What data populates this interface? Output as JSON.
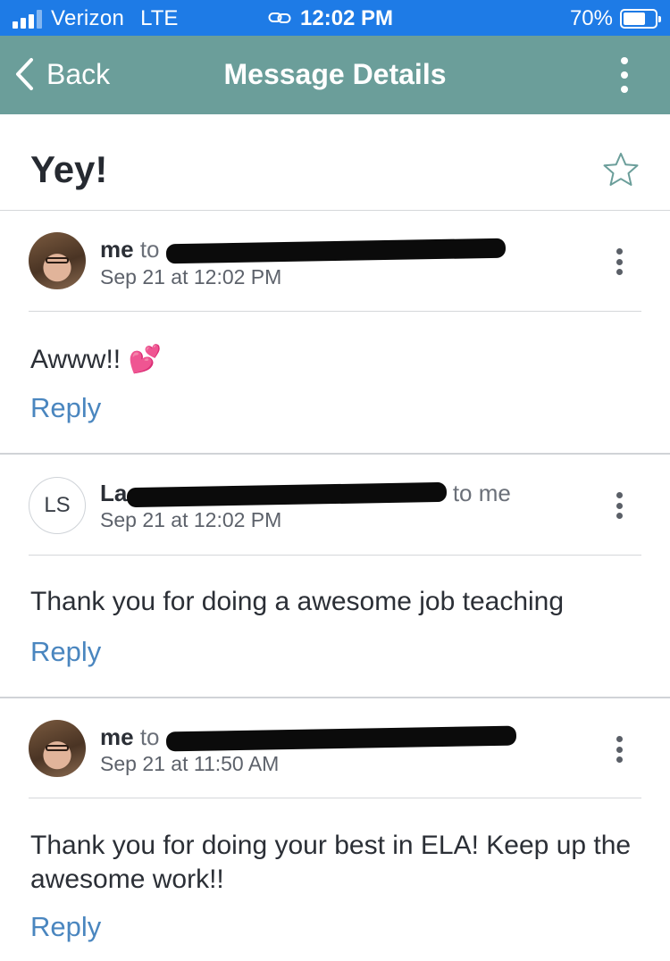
{
  "status_bar": {
    "carrier": "Verizon",
    "network": "LTE",
    "time": "12:02 PM",
    "battery": "70%",
    "battery_level": 0.7
  },
  "nav": {
    "back_label": "Back",
    "title": "Message Details"
  },
  "subject": "Yey!",
  "messages": [
    {
      "sender": "me",
      "to_label": "to",
      "avatar_initials": "",
      "date": "Sep 21 at 12:02 PM",
      "body": "Awww!! 💕",
      "reply_label": "Reply"
    },
    {
      "sender": "La",
      "to_label": "to me",
      "avatar_initials": "LS",
      "date": "Sep 21 at 12:02 PM",
      "body": "Thank you for doing a awesome job teaching",
      "reply_label": "Reply"
    },
    {
      "sender": "me",
      "to_label": "to",
      "avatar_initials": "",
      "date": "Sep 21 at 11:50 AM",
      "body": "Thank you for doing your best in ELA! Keep up the awesome work!!",
      "reply_label": "Reply"
    }
  ],
  "colors": {
    "status_bar": "#1e7be6",
    "nav_bar": "#6b9e9a",
    "reply_link": "#4a86bf",
    "star_outline": "#6b9e9a"
  },
  "icons": {
    "back": "chevron-left-icon",
    "menu": "more-vertical-icon",
    "star": "star-outline-icon",
    "signal": "signal-bars-icon",
    "link": "link-icon",
    "battery": "battery-icon"
  }
}
